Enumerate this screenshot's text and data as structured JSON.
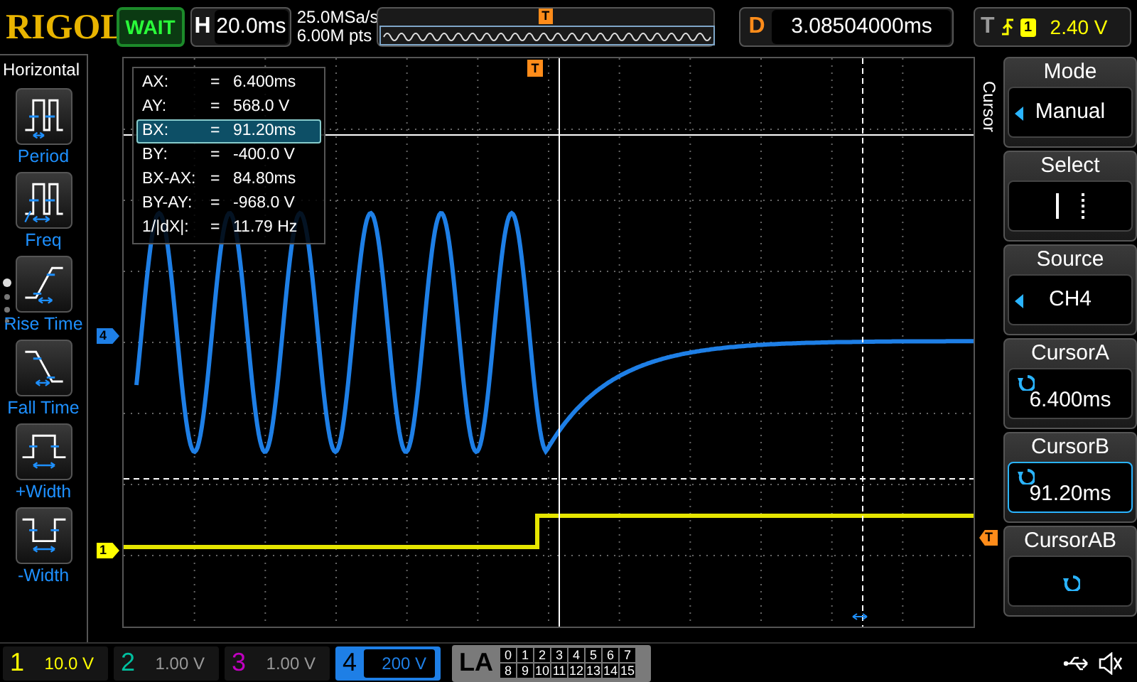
{
  "header": {
    "logo": "RIGOL",
    "run_status": "WAIT",
    "timebase": {
      "label": "H",
      "value": "20.0ms"
    },
    "sample_rate": "25.0MSa/s",
    "memory_depth": "6.00M pts",
    "overview_marker": "T",
    "delay": {
      "label": "D",
      "value": "3.08504000ms"
    },
    "trigger": {
      "label": "T",
      "source": "1",
      "level": "2.40 V"
    }
  },
  "sidebar": {
    "title": "Horizontal",
    "items": [
      {
        "kind": "period",
        "label": "Period"
      },
      {
        "kind": "freq",
        "label": "Freq"
      },
      {
        "kind": "rise",
        "label": "Rise Time"
      },
      {
        "kind": "fall",
        "label": "Fall Time"
      },
      {
        "kind": "pwidth",
        "label": "+Width"
      },
      {
        "kind": "nwidth",
        "label": "-Width"
      }
    ]
  },
  "markers": [
    {
      "kind": "channel",
      "label": "4",
      "color": "#1e7fe6"
    },
    {
      "kind": "channel",
      "label": "1",
      "color": "#ffff00"
    },
    {
      "kind": "trigger_position",
      "label": "T"
    },
    {
      "kind": "trigger_level",
      "label": "T"
    }
  ],
  "cursor_readout": [
    {
      "label": "AX:",
      "sign": "=",
      "value": "6.400ms",
      "selected": false
    },
    {
      "label": "AY:",
      "sign": "=",
      "value": "568.0 V",
      "selected": false
    },
    {
      "label": "BX:",
      "sign": "=",
      "value": "91.20ms",
      "selected": true
    },
    {
      "label": "BY:",
      "sign": "=",
      "value": "-400.0 V",
      "selected": false
    },
    {
      "label": "BX-AX:",
      "sign": "=",
      "value": "84.80ms",
      "selected": false
    },
    {
      "label": "BY-AY:",
      "sign": "=",
      "value": "-968.0 V",
      "selected": false
    },
    {
      "label": "1/|dX|:",
      "sign": "=",
      "value": "11.79 Hz",
      "selected": false
    }
  ],
  "menu": {
    "title": "Cursor",
    "items": [
      {
        "kind": "option",
        "label": "Mode",
        "value": "Manual",
        "selected": false
      },
      {
        "kind": "cursor_select",
        "label": "Select",
        "selected": false
      },
      {
        "kind": "option",
        "label": "Source",
        "value": "CH4",
        "selected": false
      },
      {
        "kind": "knob",
        "label": "CursorA",
        "value": "6.400ms",
        "selected": false
      },
      {
        "kind": "knob",
        "label": "CursorB",
        "value": "91.20ms",
        "selected": true
      },
      {
        "kind": "knob",
        "label": "CursorAB",
        "selected": false
      }
    ]
  },
  "channels": [
    {
      "number": "1",
      "scale": "10.0 V",
      "on": true,
      "selected": false,
      "color": "#ffff00"
    },
    {
      "number": "2",
      "scale": "1.00 V",
      "on": false,
      "selected": false,
      "color": "#00c0a0"
    },
    {
      "number": "3",
      "scale": "1.00 V",
      "on": false,
      "selected": false,
      "color": "#c000c0"
    },
    {
      "number": "4",
      "scale": "200 V",
      "on": true,
      "selected": true,
      "color": "#1e7fe6"
    }
  ],
  "logic_analyzer": {
    "label": "LA",
    "bits": [
      "0",
      "1",
      "2",
      "3",
      "4",
      "5",
      "6",
      "7",
      "8",
      "9",
      "10",
      "11",
      "12",
      "13",
      "14",
      "15"
    ]
  }
}
